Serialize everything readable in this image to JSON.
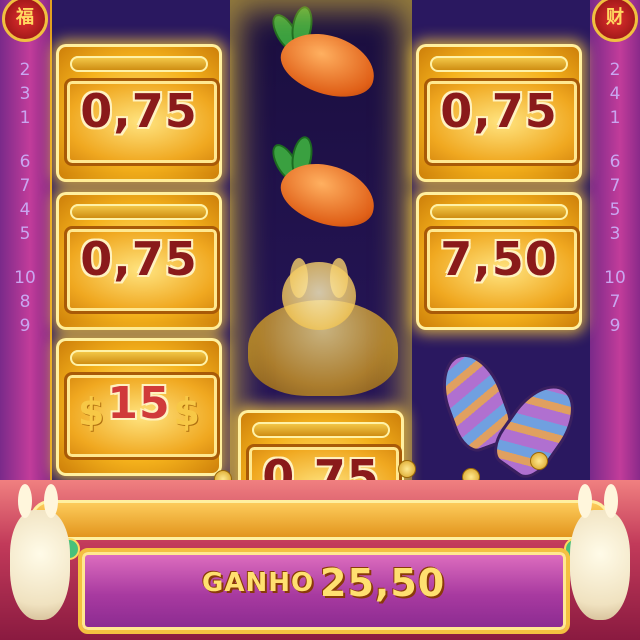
{
  "reels": {
    "left": {
      "tiles": [
        "0,75",
        "0,75",
        "15"
      ]
    },
    "middle": {
      "symbols": [
        "carrot-icon",
        "carrot-icon",
        "rabbit-ingot-icon"
      ],
      "tile": "0,75"
    },
    "right": {
      "tiles": [
        "0,75",
        "7,50"
      ],
      "symbol": "rocket-icon"
    }
  },
  "paylines": {
    "left": [
      "2",
      "3",
      "1",
      "6",
      "7",
      "4",
      "5",
      "10",
      "8",
      "9"
    ],
    "right": [
      "2",
      "4",
      "1",
      "6",
      "7",
      "5",
      "3",
      "10",
      "7",
      "9"
    ]
  },
  "win": {
    "label": "GANHO",
    "amount": "25,50"
  },
  "colors": {
    "tile_gold": "#f5b21c",
    "value_text": "#8a1a1a",
    "bonus_value_text": "#d03a3a",
    "win_text": "#ffe070",
    "win_bar": "#a83aa0"
  }
}
